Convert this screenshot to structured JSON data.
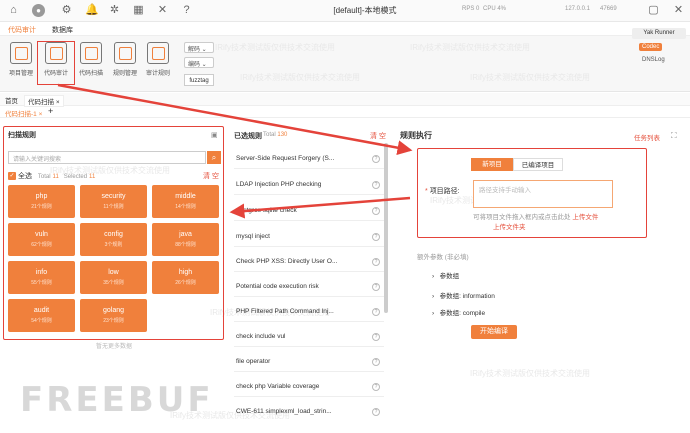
{
  "window": {
    "title": "[default]-本地模式",
    "rps": "RPS 0",
    "cpu": "CPU 4%",
    "ip": "127.0.0.1",
    "port": "47669"
  },
  "menutabs": [
    "代码审计",
    "数据库"
  ],
  "ribbon": {
    "buttons": [
      "项目管理",
      "代码审计",
      "代码扫描",
      "规则管理",
      "审计规则"
    ],
    "decode": "解码",
    "encode": "编码",
    "fuzztag": "fuzztag"
  },
  "runner": "Yak Runner",
  "codec": "Codec",
  "dnslog": "DNSLog",
  "tabs": {
    "home": "首页",
    "scan": "代码扫描",
    "sub": "代码扫描-1"
  },
  "scan": {
    "title": "扫描规则",
    "placeholder": "请输入关键词搜索",
    "all": "全选",
    "total_label": "Total",
    "total": "11",
    "selected_label": "Selected",
    "selected": "11",
    "clear": "清 空",
    "nomore": "暂无更多数据",
    "categories": [
      {
        "name": "php",
        "count": "21个规则"
      },
      {
        "name": "security",
        "count": "11个规则"
      },
      {
        "name": "middle",
        "count": "14个规则"
      },
      {
        "name": "vuln",
        "count": "62个规则"
      },
      {
        "name": "config",
        "count": "3个规则"
      },
      {
        "name": "java",
        "count": "88个规则"
      },
      {
        "name": "info",
        "count": "55个规则"
      },
      {
        "name": "low",
        "count": "35个规则"
      },
      {
        "name": "high",
        "count": "26个规则"
      },
      {
        "name": "audit",
        "count": "54个规则"
      },
      {
        "name": "golang",
        "count": "23个规则"
      }
    ]
  },
  "selected": {
    "title": "已选规则",
    "total_label": "Total",
    "total": "130",
    "clear": "清 空",
    "rules": [
      "Server-Side Request Forgery (S...",
      "LDAP Injection PHP checking",
      "postgres sqlite check",
      "mysql inject",
      "Check PHP XSS: Directly User O...",
      "Potential code execution risk",
      "PHP Filtered Path Command Inj...",
      "check include vul",
      "file operator",
      "check php Variable coverage",
      "CWE-611 simplexml_load_strin..."
    ]
  },
  "exec": {
    "title": "规则执行",
    "tasklist": "任务列表",
    "seg_new": "新项目",
    "seg_compiled": "已编译项目",
    "path_label": "项目路径:",
    "path_placeholder": "路径支持手动输入",
    "hint_prefix": "可将项目文件拖入框内或点击此处",
    "hint_link": "上传文件",
    "hint_link2": "上传文件夹",
    "extra": "额外参数 (非必填)",
    "params": [
      "参数组",
      "参数组: information",
      "参数组: compile"
    ],
    "compile": "开始编译"
  },
  "watermark": "IRify技术测试版仅供技术交流使用",
  "logo": "FREEBUF",
  "colors": {
    "accent": "#f0803c",
    "annotation": "#e4433a"
  }
}
